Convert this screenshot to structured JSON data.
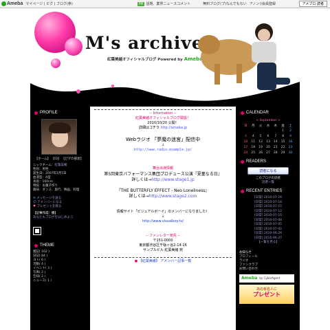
{
  "topbar": {
    "logo": "Ameba",
    "nav": "マイページ | ピグ | ブログ(参)",
    "pr": "PR",
    "promo1": "話題、業界ニュースコメント",
    "promo2": "無料ブログ(プ)なんでもない",
    "promo3": "アノン!/会員登録",
    "ameblo": "アメブロ 読者"
  },
  "header": {
    "title": "M's archiver",
    "subtitle": "紅葉美緒オフィシャルブログ Powered by",
    "brand": "Ameba"
  },
  "left": {
    "profile_head": "PROFILE",
    "links": "【ホーム】 【ID】 【ピグの部屋】",
    "nickname_label": "ニックネーム：",
    "nickname": "紅葉美緒",
    "info": [
      "性別：男性",
      "誕生日：2007年1月5日",
      "血液型：A型",
      "身長：160cm",
      "特技：お菓子作り",
      "興味：ダンス、旅行、映画、料理"
    ],
    "msg_link": "メッセージを送る",
    "amigo_link": "アメンバーになる",
    "present_link": "プレゼントを贈る",
    "record_label": "【記事作成：備】",
    "record_link": "あなたもブログをはじめよう",
    "theme_head": "THEME",
    "themes": [
      "雑記( 102 )",
      "日記( 84 )",
      "ヨト( 6 )",
      "活動( 4 )",
      "イベント( 3 )",
      "写真( 2 )",
      "告知( 2 )",
      "ニュース( 1 )"
    ]
  },
  "right": {
    "cal_head": "CALENDAR",
    "cal_month": "< September >",
    "cal_days": [
      "日",
      "月",
      "火",
      "水",
      "木",
      "金",
      "土"
    ],
    "cal_weeks": [
      [
        "",
        "",
        "",
        "",
        "",
        "1",
        "2"
      ],
      [
        "3",
        "4",
        "5",
        "6",
        "7",
        "8",
        "9"
      ],
      [
        "10",
        "11",
        "12",
        "13",
        "14",
        "15",
        "16"
      ],
      [
        "17",
        "18",
        "19",
        "20",
        "21",
        "22",
        "23"
      ],
      [
        "24",
        "25",
        "26",
        "27",
        "28",
        "29",
        "30"
      ]
    ],
    "readers_head": "READERS",
    "reader_button": "読者になる",
    "readers_text": "このブログの読者",
    "readers_link": "読者一覧",
    "recent_head": "RECENT ENTRIES",
    "entries": [
      "[日常] 2010-07-19",
      "[日常] 2010-07-18",
      "[日常] 2010-07-15",
      "[日常] 2010-07-12",
      "[日常] 2010-07-10",
      "[日常] 2010-07-08",
      "[日常] 2010-07-05",
      "[日常] 2010-07-02",
      "[日常] 2010-06-29",
      "[日常] 2010-06-27"
    ],
    "all_entries": "【一覧を見る】",
    "links_head": "お知らせ",
    "links": [
      "プロフィール",
      "ラジオ",
      "ファンクラブ",
      "お問い合わせ"
    ],
    "ameba_text": "Ameba",
    "ameba_sub": "by CyberAgent",
    "present_banner": "あの有名人に",
    "present_banner2": "プレゼント"
  },
  "main": {
    "info_head": "Information",
    "info_line1": "紅葉美緒オフィシャルブログ開設！",
    "info_date": "2010/10/20 公開！",
    "info_url_label": "詳細はコチラ",
    "info_url": "http://ameba.jp",
    "radio": "Webラジオ 「夢魔の迷宮」配信中",
    "radio_arrow": "↓",
    "radio_url": "http://www.radio.example.jp/",
    "stage_head": "舞台出演情報",
    "stage1": "第5回東京パフォーマンス集団プロデュース公演『夏菫なる日』",
    "stage1_label": "詳しくは→",
    "stage1_url": "http://www.stage1.jp",
    "stage2": "『THE BUTTERFLY EFFECT - Neo Loneliness』",
    "stage2_label": "詳しくは→",
    "stage2_url": "http://www.stage2.com",
    "visual_text": "情報サイト「ビジュアルボーイ」のメンバーになりました！",
    "visual_arrow": "↓",
    "visual_url": "http://www.visualboy.tv/",
    "fan_head": "ファンレター宛先",
    "fan_addr1": "〒151-0000",
    "fan_addr2": "東京都渋谷区千駄ヶ谷2-14-16",
    "fan_addr3": "サンプルビル 紅葉美緒 宛",
    "bottom_link": "【紅葉美緒】 アメンバー記事一覧"
  },
  "colors": {
    "accent": "#e0006c",
    "frame": "#000000"
  }
}
